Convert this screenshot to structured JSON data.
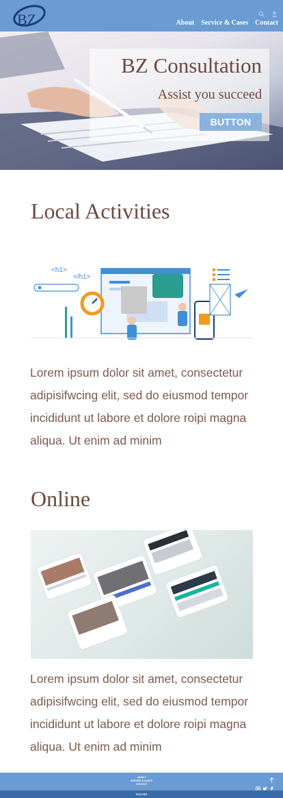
{
  "header": {
    "logo_text": "BZ",
    "nav": [
      {
        "label": "About"
      },
      {
        "label": "Service & Cases"
      },
      {
        "label": "Contact"
      }
    ],
    "icons": [
      "search-icon",
      "user-icon"
    ]
  },
  "hero": {
    "title": "BZ Consultation",
    "subtitle": "Assist you succeed",
    "button_label": "BUTTON"
  },
  "sections": {
    "local": {
      "heading": "Local Activities",
      "illustration_labels": [
        "<h1>",
        "</h1>"
      ],
      "text": "Lorem ipsum dolor sit amet, consectetur adipisifwcing elit, sed do eiusmod tempor incididunt ut labore et dolore roipi magna aliqua. Ut enim ad minim"
    },
    "online": {
      "heading": "Online",
      "text": "Lorem ipsum dolor sit amet, consectetur adipisifwcing elit, sed do eiusmod tempor incididunt ut labore et dolore roipi magna aliqua. Ut enim ad minim"
    }
  },
  "footer": {
    "links": [
      "ABOUT",
      "SERVICE & CASES",
      "CONTACT"
    ],
    "bar_label": "FOOTER",
    "icons": [
      "arrow-up-icon",
      "instagram-icon",
      "twitter-icon",
      "facebook-icon"
    ]
  },
  "colors": {
    "header_bg": "#6a9bd3",
    "heading_brown": "#6b4a3e",
    "text_brown": "#7b5a4e",
    "button_bg": "#8ab2df",
    "footer_bar": "#3a6ba8"
  }
}
